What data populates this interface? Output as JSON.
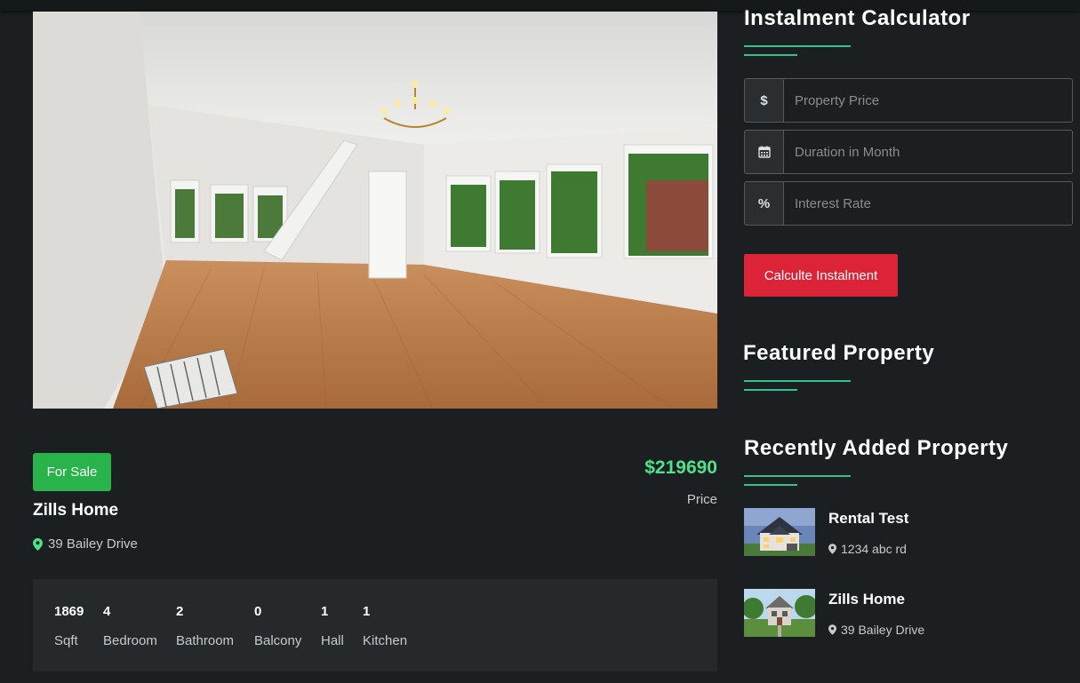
{
  "property": {
    "status_badge": "For Sale",
    "title": "Zills Home",
    "address": "39 Bailey Drive",
    "price": "$219690",
    "price_label": "Price",
    "stats": [
      {
        "value": "1869",
        "label": "Sqft"
      },
      {
        "value": "4",
        "label": "Bedroom"
      },
      {
        "value": "2",
        "label": "Bathroom"
      },
      {
        "value": "0",
        "label": "Balcony"
      },
      {
        "value": "1",
        "label": "Hall"
      },
      {
        "value": "1",
        "label": "Kitchen"
      }
    ],
    "photo_icon": "interior-room-photo"
  },
  "calculator": {
    "title": "Instalment Calculator",
    "fields": [
      {
        "addon": "$",
        "placeholder": "Property Price",
        "value": ""
      },
      {
        "addon_icon": "calendar-icon",
        "placeholder": "Duration in Month",
        "value": ""
      },
      {
        "addon": "%",
        "placeholder": "Interest Rate",
        "value": ""
      }
    ],
    "button_label": "Calculte Instalment"
  },
  "featured": {
    "title": "Featured Property"
  },
  "recent": {
    "title": "Recently Added Property",
    "items": [
      {
        "title": "Rental Test",
        "address": "1234 abc rd",
        "thumb_icon": "house-night-thumbnail"
      },
      {
        "title": "Zills Home",
        "address": "39 Bailey Drive",
        "thumb_icon": "house-day-thumbnail"
      }
    ]
  },
  "colors": {
    "background": "#1c1f21",
    "panel": "#25292b",
    "accent_green": "#2fc48a",
    "price_green": "#4fe28a",
    "badge_green": "#28b44a",
    "button_red": "#dc2337"
  }
}
